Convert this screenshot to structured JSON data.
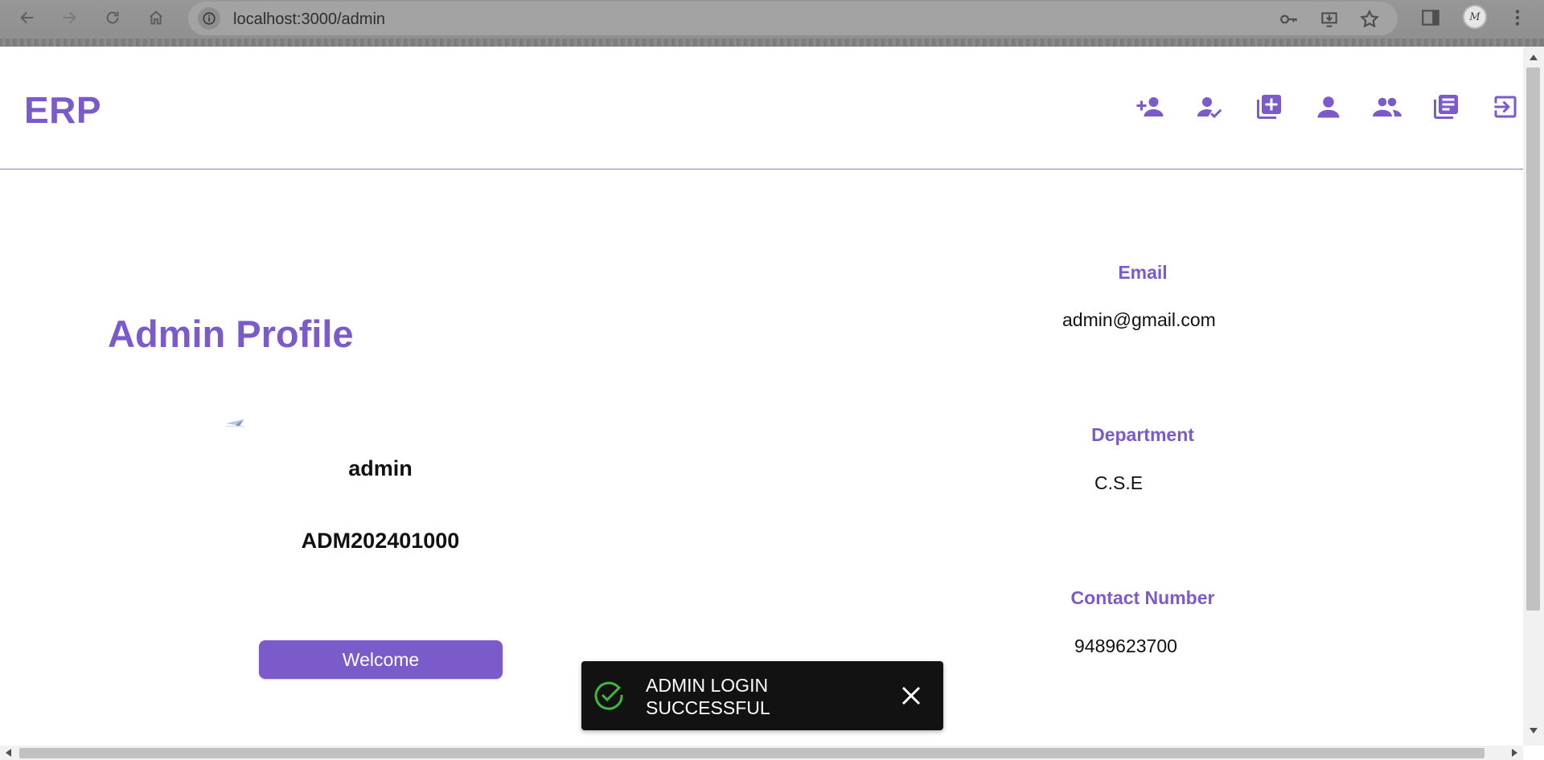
{
  "browser": {
    "url": "localhost:3000/admin",
    "icons": {
      "back": "arrow-left-icon",
      "forward": "arrow-right-icon",
      "reload": "reload-icon",
      "home": "home-icon",
      "site_info": "info-icon",
      "passwords": "key-icon",
      "install": "install-app-icon",
      "bookmark": "star-icon",
      "side_panel": "side-panel-icon",
      "menu": "kebab-menu-icon"
    },
    "profile_initials": "M"
  },
  "header": {
    "logo": "ERP",
    "nav_icons": [
      "add-user-icon",
      "user-check-icon",
      "add-box-icon",
      "person-icon",
      "people-icon",
      "library-books-icon",
      "logout-icon"
    ]
  },
  "profile": {
    "title": "Admin Profile",
    "name": "admin",
    "id": "ADM202401000",
    "welcome_label": "Welcome"
  },
  "details": {
    "email_label": "Email",
    "email_value": "admin@gmail.com",
    "department_label": "Department",
    "department_value": "C.S.E",
    "contact_label": "Contact Number",
    "contact_value": "9489623700"
  },
  "toast": {
    "line1": "ADMIN LOGIN",
    "line2": "SUCCESSFUL"
  },
  "colors": {
    "accent": "#7b5ac9",
    "toast_bg": "#121212",
    "success": "#3fb83f"
  }
}
